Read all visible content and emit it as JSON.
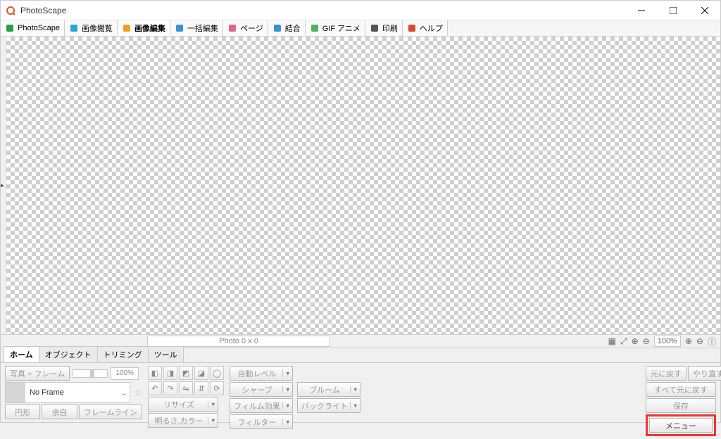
{
  "window": {
    "title": "PhotoScape"
  },
  "mainTabs": [
    {
      "label": "PhotoScape",
      "iconColor": "#23a04a"
    },
    {
      "label": "画像閲覧",
      "iconColor": "#2aa5d8"
    },
    {
      "label": "画像編集",
      "iconColor": "#f0a020",
      "active": true
    },
    {
      "label": "一括編集",
      "iconColor": "#3c92d1"
    },
    {
      "label": "ページ",
      "iconColor": "#e06688"
    },
    {
      "label": "結合",
      "iconColor": "#3c92d1"
    },
    {
      "label": "GIF アニメ",
      "iconColor": "#52b35e"
    },
    {
      "label": "印刷",
      "iconColor": "#555"
    },
    {
      "label": "ヘルプ",
      "iconColor": "#d94b2a"
    }
  ],
  "status": {
    "photoInfo": "Photo 0 x 0",
    "zoom": "100%"
  },
  "subTabs": [
    {
      "label": "ホーム",
      "active": true
    },
    {
      "label": "オブジェクト"
    },
    {
      "label": "トリミング"
    },
    {
      "label": "ツール"
    }
  ],
  "frame": {
    "photoFrameBtn": "写真 + フレーム",
    "sliderPct": "100%",
    "noFrameLabel": "No Frame",
    "round": "円形",
    "margin": "余白",
    "frameline": "フレームライン"
  },
  "adjust": {
    "autoLevel": "自動レベル",
    "sharpen": "シャープ",
    "bloom": "ブルーム",
    "resize": "リサイズ",
    "film": "フィルム効果",
    "backlight": "バックライト",
    "brightColor": "明るさ,カラー",
    "filter": "フィルター"
  },
  "right": {
    "undo": "元に戻す",
    "redo": "やり直す",
    "revertAll": "すべて元に戻す",
    "save": "保存",
    "menu": "メニュー"
  }
}
